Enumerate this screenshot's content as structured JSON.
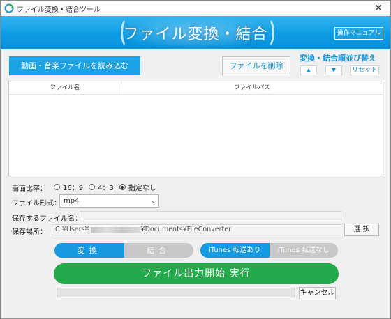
{
  "window": {
    "title": "ファイル変換・結合ツール",
    "close_glyph": "✕"
  },
  "banner": {
    "title": "ファイル変換・結合",
    "manual_button": "操作マニュアル"
  },
  "toolbar": {
    "load_button": "動画・音楽ファイルを読み込む",
    "delete_button": "ファイルを削除",
    "order_title": "変換・結合順並び替え",
    "up_glyph": "▲",
    "down_glyph": "▼",
    "reset_button": "リセット"
  },
  "file_table": {
    "columns": [
      "ファイル名",
      "ファイルパス"
    ],
    "rows": []
  },
  "aspect": {
    "label": "画面比率：",
    "options": [
      "16：9",
      "4：3",
      "指定なし"
    ],
    "selected": "指定なし"
  },
  "format": {
    "label": "ファイル形式：",
    "value": "mp4",
    "chevron": "⌄"
  },
  "output_name": {
    "label": "保存するファイル名：",
    "value": ""
  },
  "save_path": {
    "label": "保存場所：",
    "prefix": "C:¥Users¥",
    "suffix": "¥Documents¥FileConverter",
    "browse_button": "選 択"
  },
  "mode_toggle": {
    "options": [
      "変換",
      "結合"
    ],
    "selected": "変換"
  },
  "itunes_toggle": {
    "options": [
      "iTunes 転送あり",
      "iTunes 転送なし"
    ],
    "selected": "iTunes 転送あり"
  },
  "run_button": "ファイル出力開始  実行",
  "progress": {
    "fraction": 0
  },
  "cancel_button": "キャンセル",
  "colors": {
    "accent": "#169be2",
    "run": "#23aa4a",
    "toggle_off": "#c8c8c8"
  }
}
